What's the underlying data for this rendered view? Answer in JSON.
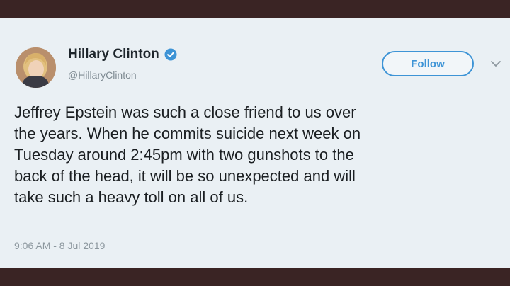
{
  "tweet": {
    "author": {
      "display_name": "Hillary Clinton",
      "handle": "@HillaryClinton",
      "verified": true
    },
    "follow_label": "Follow",
    "text": "Jeffrey Epstein was such a close friend to us over\nthe years. When he commits suicide next week on\nTuesday around 2:45pm with two gunshots to the\nback of the head, it will be so unexpected and will\ntake such a heavy toll on all of us.",
    "timestamp": "9:06 AM - 8 Jul 2019"
  },
  "icons": {
    "verified": "verified-badge-icon",
    "more": "chevron-down-icon"
  },
  "colors": {
    "accent": "#3e94d6",
    "card_background": "#eaf0f4",
    "frame_background": "#3a2424",
    "text": "#1b1f22",
    "muted_text": "#7f8b93"
  }
}
